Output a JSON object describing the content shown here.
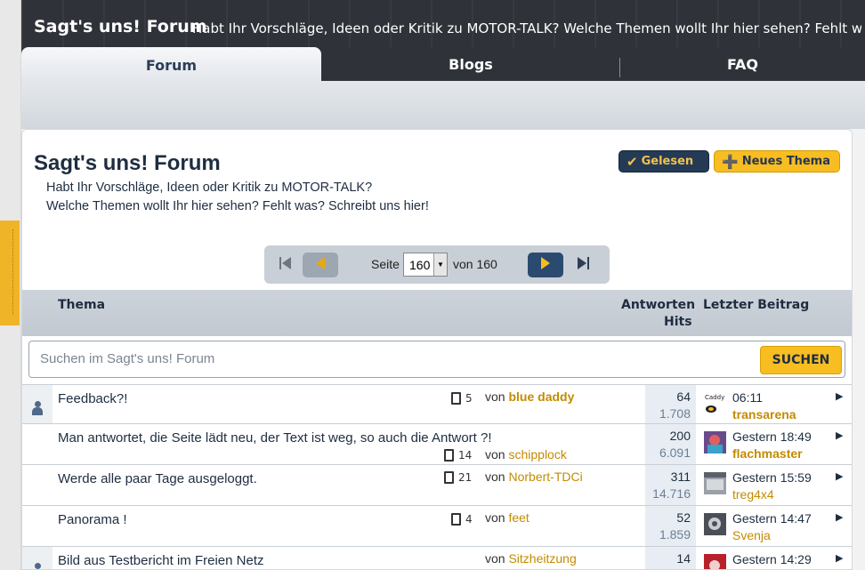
{
  "header": {
    "forum_title": "Sagt's uns! Forum",
    "forum_desc": "Habt Ihr Vorschläge, Ideen oder Kritik zu MOTOR-TALK? Welche Themen wollt Ihr hier sehen? Fehlt was? Schreibt"
  },
  "tabs": [
    {
      "label": "Forum",
      "active": true
    },
    {
      "label": "Blogs",
      "active": false
    },
    {
      "label": "FAQ",
      "active": false
    }
  ],
  "page": {
    "title": "Sagt's uns! Forum",
    "desc_line1": "Habt Ihr Vorschläge, Ideen oder Kritik zu MOTOR-TALK?",
    "desc_line2": "Welche Themen wollt Ihr hier sehen? Fehlt was? Schreibt uns hier!",
    "btn_gelesen": "Gelesen",
    "btn_neues": "Neues Thema"
  },
  "pager": {
    "label": "Seite",
    "current": "160",
    "of_label": "von 160"
  },
  "columns": {
    "thema": "Thema",
    "antworten": "Antworten",
    "hits": "Hits",
    "letzter": "Letzter Beitrag"
  },
  "search": {
    "placeholder": "Suchen im Sagt's uns! Forum",
    "button": "SUCHEN"
  },
  "topics": [
    {
      "title": "Feedback?!",
      "pages": "5",
      "von": "von",
      "user": "blue daddy",
      "answers": "64",
      "hits": "1.708",
      "time": "06:11",
      "last_user": "transarena"
    },
    {
      "title": "Man antwortet, die Seite lädt neu, der Text ist weg, so auch die Antwort ?!",
      "pages": "14",
      "von": "von",
      "user": "schipplock",
      "answers": "200",
      "hits": "6.091",
      "time": "Gestern 18:49",
      "last_user": "flachmaster"
    },
    {
      "title": "Werde alle paar Tage ausgeloggt.",
      "pages": "21",
      "von": "von",
      "user": "Norbert-TDCi",
      "answers": "311",
      "hits": "14.716",
      "time": "Gestern 15:59",
      "last_user": "treg4x4"
    },
    {
      "title": "Panorama !",
      "pages": "4",
      "von": "von",
      "user": "feet",
      "answers": "52",
      "hits": "1.859",
      "time": "Gestern 14:47",
      "last_user": "Svenja"
    },
    {
      "title": "Bild aus Testbericht im Freien Netz",
      "pages": "",
      "von": "von",
      "user": "Sitzheitzung",
      "answers": "14",
      "hits": "",
      "time": "Gestern 14:29",
      "last_user": ""
    }
  ],
  "colors": {
    "header_bg": "#2f3238",
    "accent_yellow": "#f7bd21",
    "navy": "#253a55",
    "username": "#c38b00"
  },
  "icons": [
    "person-icon",
    "pages-icon",
    "chevron-right-icon",
    "checkmark-icon",
    "new-topic-icon",
    "first-page-icon",
    "prev-page-icon",
    "next-page-icon",
    "last-page-icon",
    "dropdown-arrow-icon"
  ]
}
